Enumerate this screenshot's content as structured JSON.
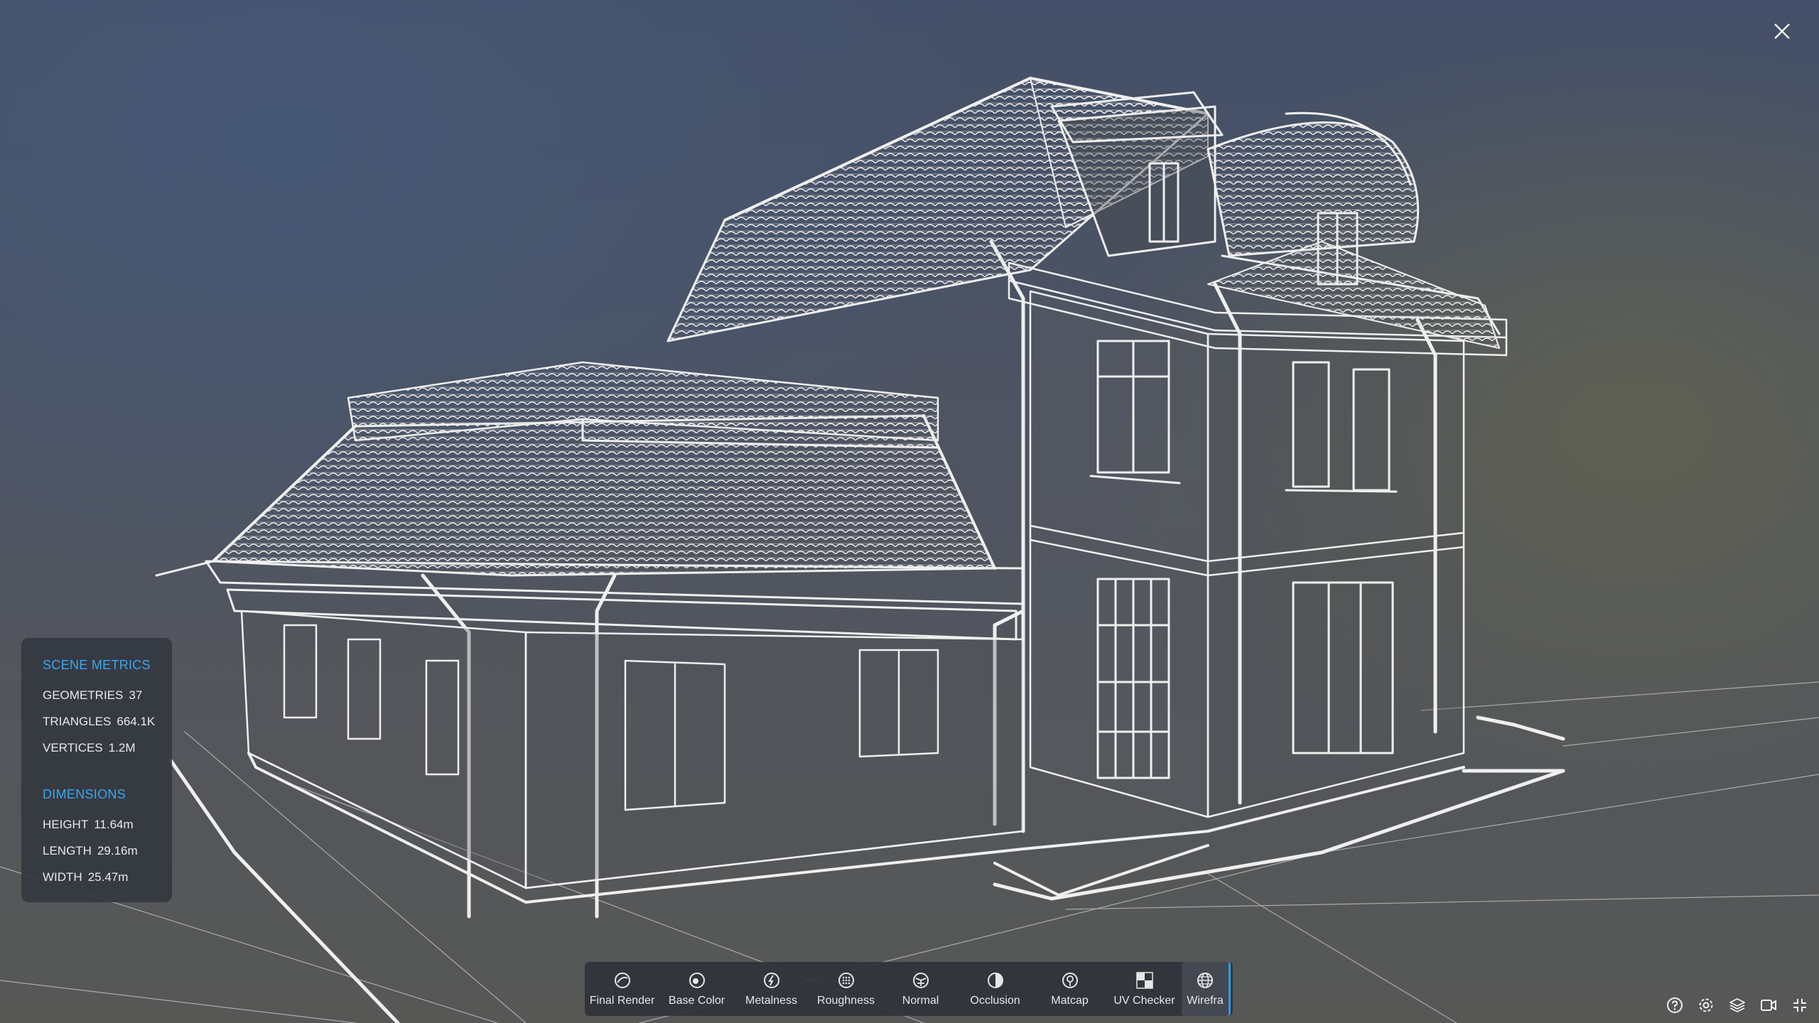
{
  "metrics": {
    "scene_heading": "SCENE METRICS",
    "geometries_label": "GEOMETRIES",
    "geometries_value": "37",
    "triangles_label": "TRIANGLES",
    "triangles_value": "664.1K",
    "vertices_label": "VERTICES",
    "vertices_value": "1.2M",
    "dimensions_heading": "DIMENSIONS",
    "height_label": "HEIGHT",
    "height_value": "11.64m",
    "length_label": "LENGTH",
    "length_value": "29.16m",
    "width_label": "WIDTH",
    "width_value": "25.47m"
  },
  "toolbar": {
    "items": [
      {
        "label": "Final Render",
        "icon": "final-render-icon"
      },
      {
        "label": "Base Color",
        "icon": "base-color-icon"
      },
      {
        "label": "Metalness",
        "icon": "metalness-icon"
      },
      {
        "label": "Roughness",
        "icon": "roughness-icon"
      },
      {
        "label": "Normal",
        "icon": "normal-icon"
      },
      {
        "label": "Occlusion",
        "icon": "occlusion-icon"
      },
      {
        "label": "Matcap",
        "icon": "matcap-icon"
      },
      {
        "label": "UV Checker",
        "icon": "uv-checker-icon"
      },
      {
        "label": "Wirefra",
        "icon": "wireframe-icon"
      }
    ],
    "active": "Wirefra"
  },
  "bottom_icons": [
    "help-icon",
    "settings-icon",
    "layers-icon",
    "vr-icon",
    "exit-fullscreen-icon"
  ],
  "colors": {
    "accent": "#2e9be8",
    "heading": "#3aa6f0",
    "panel": "#343840",
    "wire": "#f2f2f2"
  }
}
